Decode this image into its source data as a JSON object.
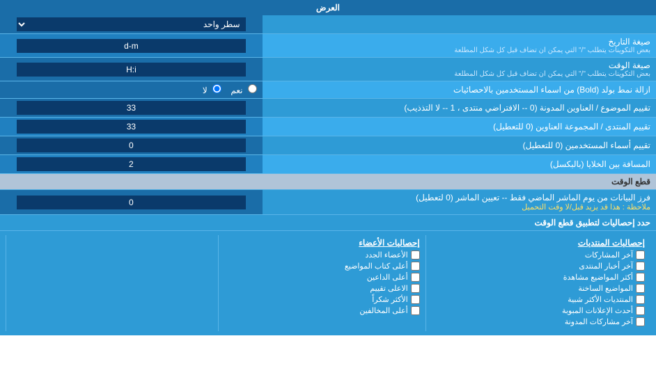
{
  "page": {
    "title": "العرض",
    "display_mode_label": "العرض",
    "display_mode_value": "سطر واحد",
    "date_format": {
      "label": "صيغة التاريخ",
      "sublabel": "بعض التكوينات يتطلب \"/\" التي يمكن ان تضاف قبل كل شكل المطلعة",
      "value": "d-m"
    },
    "time_format": {
      "label": "صيغة الوقت",
      "sublabel": "بعض التكوينات يتطلب \"/\" التي يمكن ان تضاف قبل كل شكل المطلعة",
      "value": "H:i"
    },
    "bold_option": {
      "label": "ازالة نمط بولد (Bold) من اسماء المستخدمين بالاحصائيات",
      "option_yes": "نعم",
      "option_no": "لا",
      "selected": "no"
    },
    "topic_forum_order": {
      "label": "تقييم الموضوع / العناوين المدونة (0 -- الافتراضي منتدى ، 1 -- لا التذذيب)",
      "value": "33"
    },
    "forum_group_order": {
      "label": "تقييم المنتدى / المجموعة العناوين (0 للتعطيل)",
      "value": "33"
    },
    "username_order": {
      "label": "تقييم أسماء المستخدمين (0 للتعطيل)",
      "value": "0"
    },
    "cell_spacing": {
      "label": "المسافة بين الخلايا (بالبكسل)",
      "value": "2"
    },
    "time_cut": {
      "section_title": "قطع الوقت",
      "label": "فرز البيانات من يوم الماشر الماضي فقط -- تعيين الماشر (0 لتعطيل)",
      "note": "ملاحظة : هذا قد يزيد قبل/لا وقت التحميل",
      "value": "0"
    },
    "stats_section": {
      "header_label": "حدد إحصاليات لتطبيق قطع الوقت",
      "col1_title": "إحصاليات المنتديات",
      "col1_items": [
        "آخر المشاركات",
        "آخر أخبار المنتدى",
        "أكثر المواضيع مشاهدة",
        "المواضيع الساخنة",
        "المنتديات الأكثر شبية",
        "أحدث الإعلانات المبوبة",
        "آخر مشاركات المدونة"
      ],
      "col2_title": "إحصاليات الأعضاء",
      "col2_items": [
        "الأعضاء الجدد",
        "أعلى كتاب المواضيع",
        "أعلى الداعين",
        "الاعلى تقييم",
        "الأكثر شكراً",
        "أعلى المخالفين"
      ]
    }
  }
}
